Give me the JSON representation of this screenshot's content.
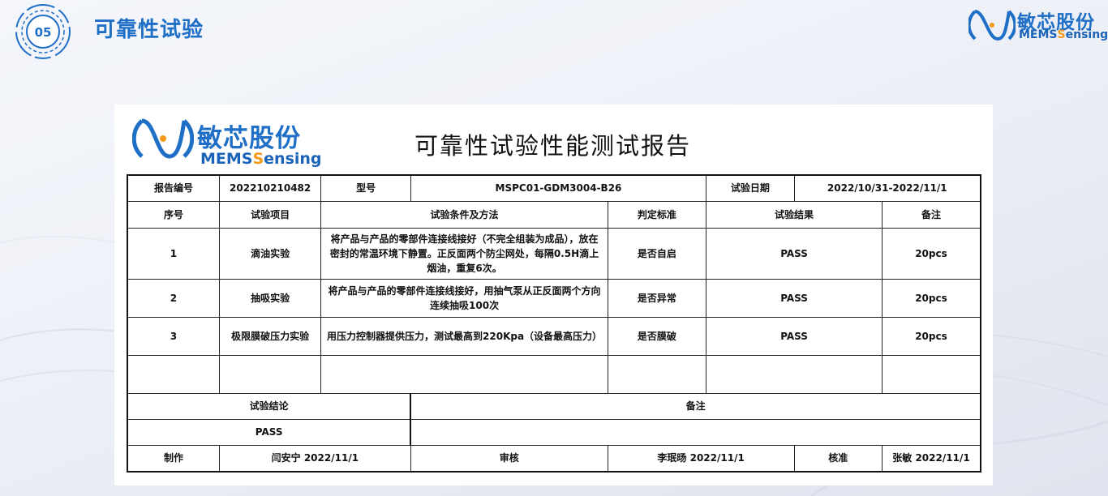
{
  "header": {
    "section_number": "05",
    "title": "可靠性试验"
  },
  "brand": {
    "name_cn": "敏芯股份",
    "name_en_prefix": "MEMS",
    "name_en_suffix": "ensing",
    "name_en_highlight": "S",
    "colors": {
      "blue": "#1f6fc7",
      "orange": "#f39a1a"
    }
  },
  "report": {
    "title": "可靠性试验性能测试报告",
    "info": {
      "report_no_label": "报告编号",
      "report_no": "202210210482",
      "model_label": "型号",
      "model": "MSPC01-GDM3004-B26",
      "date_label": "试验日期",
      "date": "2022/10/31-2022/11/1"
    },
    "columns": {
      "seq": "序号",
      "item": "试验项目",
      "method": "试验条件及方法",
      "criteria": "判定标准",
      "result": "试验结果",
      "remark": "备注"
    },
    "rows": [
      {
        "seq": "1",
        "item": "滴油实验",
        "method": "将产品与产品的零部件连接线接好（不完全组装为成品），放在密封的常温环境下静置。正反面两个防尘网处，每隔0.5H滴上烟油，重复6次。",
        "criteria": "是否自启",
        "result": "PASS",
        "remark": "20pcs"
      },
      {
        "seq": "2",
        "item": "抽吸实验",
        "method": "将产品与产品的零部件连接线接好，用抽气泵从正反面两个方向连续抽吸100次",
        "criteria": "是否异常",
        "result": "PASS",
        "remark": "20pcs"
      },
      {
        "seq": "3",
        "item": "极限膜破压力实验",
        "method": "用压力控制器提供压力，测试最高到220Kpa（设备最高压力）",
        "criteria": "是否膜破",
        "result": "PASS",
        "remark": "20pcs"
      }
    ],
    "conclusion_label": "试验结论",
    "conclusion_remark_label": "备注",
    "conclusion": "PASS",
    "signoff": {
      "made_label": "制作",
      "made": "闫安宁 2022/11/1",
      "review_label": "审核",
      "review": "李珉旸 2022/11/1",
      "approve_label": "核准",
      "approve": "张敏 2022/11/1"
    }
  }
}
